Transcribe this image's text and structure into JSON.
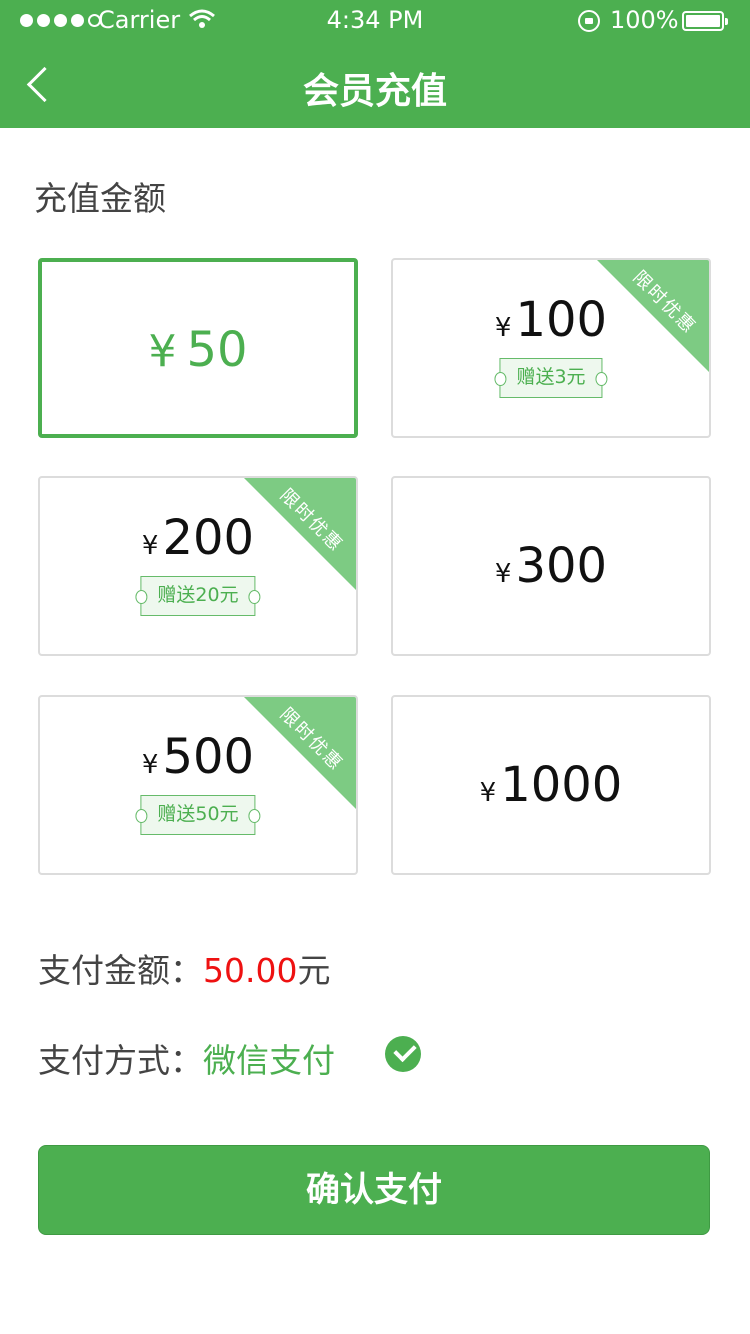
{
  "status_bar": {
    "carrier": "Carrier",
    "time": "4:34 PM",
    "battery": "100%"
  },
  "nav": {
    "title": "会员充值",
    "back_icon": "chevron-left-icon"
  },
  "section_label": "充值金额",
  "amounts": [
    {
      "yen": "¥",
      "value": "50",
      "selected": true
    },
    {
      "yen": "¥",
      "value": "100",
      "gift": "赠送3元",
      "ribbon": "限时优惠"
    },
    {
      "yen": "¥",
      "value": "200",
      "gift": "赠送20元",
      "ribbon": "限时优惠"
    },
    {
      "yen": "¥",
      "value": "300"
    },
    {
      "yen": "¥",
      "value": "500",
      "gift": "赠送50元",
      "ribbon": "限时优惠"
    },
    {
      "yen": "¥",
      "value": "1000"
    }
  ],
  "payment": {
    "amount_label": "支付金额：",
    "amount_value": "50.00",
    "amount_unit": "元",
    "method_label": "支付方式：",
    "method_value": "微信支付",
    "method_icon": "check-circle-icon"
  },
  "confirm_button": "确认支付",
  "colors": {
    "brand_green": "#4caf50",
    "ribbon_green": "#7dcb83",
    "amount_red": "#ee1111"
  }
}
